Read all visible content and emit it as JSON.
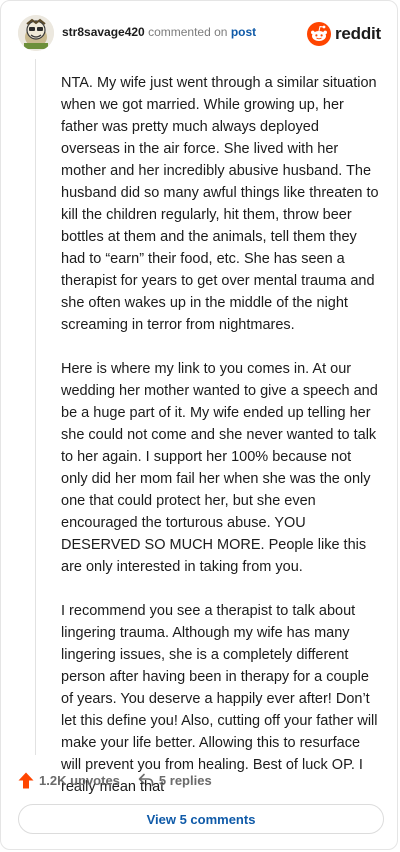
{
  "header": {
    "username": "str8savage420",
    "verb": "commented on",
    "post_link": "post",
    "brand": "reddit"
  },
  "comment": {
    "paragraphs": [
      "NTA. My wife just went through a similar situation when we got married. While growing up, her father was pretty much always deployed overseas in the air force. She lived with her mother and her incredibly abusive husband. The husband did so many awful things like threaten to kill the children regularly, hit them, throw beer bottles at them and the animals, tell them they had to “earn” their food, etc. She has seen a therapist for years to get over mental trauma and she often wakes up in the middle of the night screaming in terror from nightmares.",
      "Here is where my link to you comes in. At our wedding her mother wanted to give a speech and be a huge part of it. My wife ended up telling her she could not come and she never wanted to talk to her again. I support her 100% because not only did her mom fail her when she was the only one that could protect her, but she even encouraged the torturous abuse. YOU DESERVED SO MUCH MORE. People like this are only interested in taking from you.",
      "I recommend you see a therapist to talk about lingering trauma. Although my wife has many lingering issues, she is a completely different person after having been in therapy for a couple of years. You deserve a happily ever after! Don’t let this define you! Also, cutting off your father will make your life better. Allowing this to resurface will prevent you from healing. Best of luck OP. I really mean that"
    ]
  },
  "actions": {
    "upvotes": "1.2K upvotes",
    "replies": "5 replies"
  },
  "footer": {
    "view_comments": "View 5 comments"
  },
  "colors": {
    "upvote": "#ff4500",
    "link": "#0f5aa8",
    "brand": "#ff4500"
  },
  "icons": [
    "avatar",
    "reddit-logo-icon",
    "upvote-arrow-icon",
    "reply-icon"
  ]
}
